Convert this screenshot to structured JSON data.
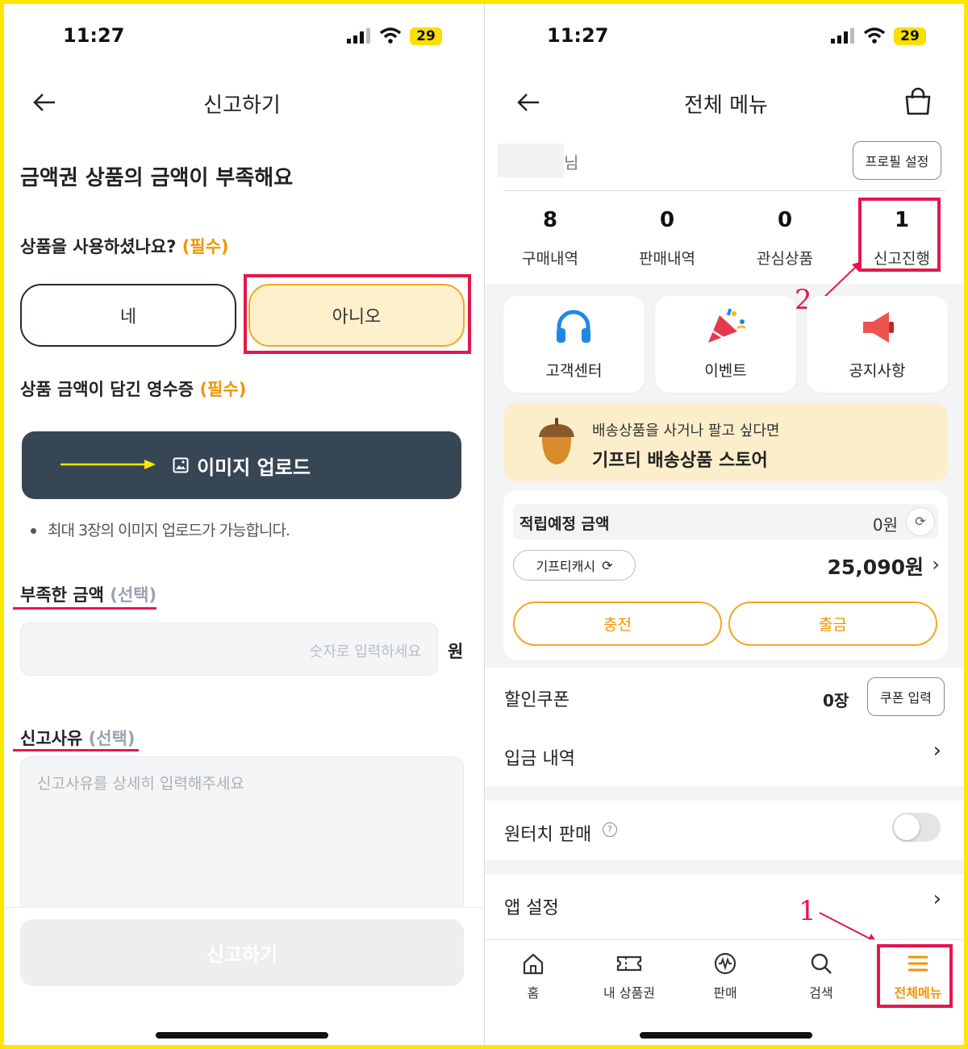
{
  "left": {
    "status": {
      "time": "11:27",
      "battery": "29"
    },
    "title": "신고하기",
    "heading": "금액권 상품의 금액이 부족해요",
    "q1": {
      "text": "상품을 사용하셨나요?",
      "tag": "(필수)"
    },
    "options": {
      "yes": "네",
      "no": "아니오"
    },
    "q2": {
      "text": "상품 금액이 담긴 영수증",
      "tag": "(필수)"
    },
    "upload_label": "이미지 업로드",
    "upload_note": "최대 3장의 이미지 업로드가 가능합니다.",
    "q3": {
      "text": "부족한 금액",
      "tag": "(선택)"
    },
    "amount_placeholder": "숫자로 입력하세요",
    "amount_unit": "원",
    "q4": {
      "text": "신고사유",
      "tag": "(선택)"
    },
    "reason_placeholder": "신고사유를 상세히 입력해주세요",
    "submit_label": "신고하기"
  },
  "right": {
    "status": {
      "time": "11:27",
      "battery": "29"
    },
    "title": "전체 메뉴",
    "profile_suffix": "님",
    "profile_btn": "프로필 설정",
    "stats": [
      {
        "num": "8",
        "label": "구매내역"
      },
      {
        "num": "0",
        "label": "판매내역"
      },
      {
        "num": "0",
        "label": "관심상품"
      },
      {
        "num": "1",
        "label": "신고진행"
      }
    ],
    "tiles": [
      {
        "label": "고객센터",
        "icon": "headphones-icon"
      },
      {
        "label": "이벤트",
        "icon": "party-popper-icon"
      },
      {
        "label": "공지사항",
        "icon": "megaphone-icon"
      }
    ],
    "banner": {
      "sub": "배송상품을 사거나 팔고 싶다면",
      "main": "기프티 배송상품 스토어"
    },
    "wallet": {
      "pending_label": "적립예정 금액",
      "pending_value": "0원",
      "cash_label": "기프티캐시",
      "cash_value": "25,090원",
      "charge": "충전",
      "withdraw": "출금"
    },
    "menu": {
      "coupon": "할인쿠폰",
      "coupon_count": "0장",
      "coupon_btn": "쿠폰 입력",
      "deposit": "입금 내역",
      "onetouch": "원터치 판매",
      "settings": "앱 설정"
    },
    "tabs": [
      {
        "label": "홈"
      },
      {
        "label": "내 상품권"
      },
      {
        "label": "판매"
      },
      {
        "label": "검색"
      },
      {
        "label": "전체메뉴"
      }
    ],
    "annotations": {
      "one": "1",
      "two": "2"
    }
  },
  "colors": {
    "accent": "#f29400",
    "highlight": "#e4174d",
    "dark_button": "#374654",
    "frame": "#ffe600"
  }
}
